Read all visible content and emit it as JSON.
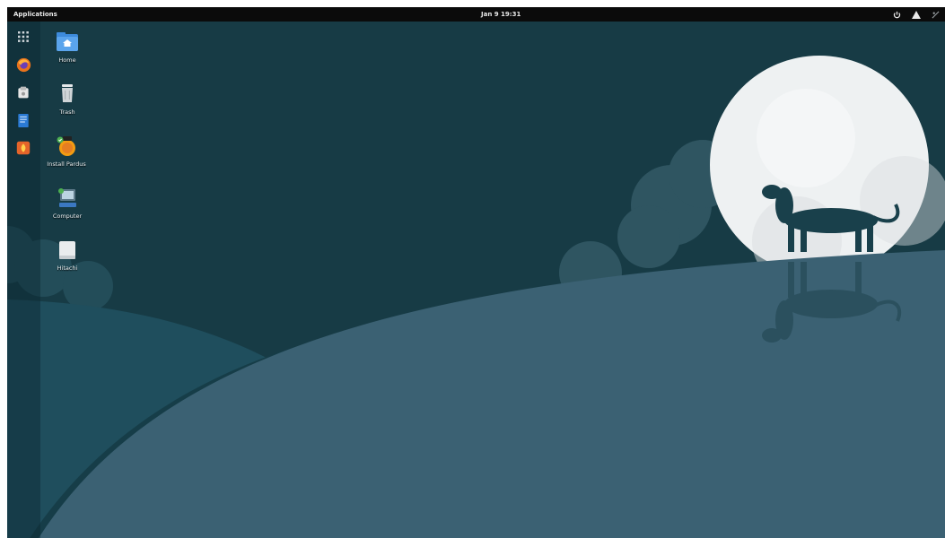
{
  "topbar": {
    "applications_label": "Applications",
    "clock": "Jan 9  19:31",
    "tray_icons": [
      "power-icon",
      "network-icon",
      "volume-icon"
    ]
  },
  "dock": {
    "items": [
      {
        "name": "app-grid-icon",
        "color": "#cfd6da"
      },
      {
        "name": "firefox-icon",
        "color": "#e8731c"
      },
      {
        "name": "software-icon",
        "color": "#e6e6e6"
      },
      {
        "name": "libreoffice-writer-icon",
        "color": "#2a7ad4"
      },
      {
        "name": "installer-icon",
        "color": "#e4642a"
      }
    ]
  },
  "desktop": {
    "icons": [
      {
        "label": "Home",
        "icon": "home-folder-icon"
      },
      {
        "label": "Trash",
        "icon": "trash-icon"
      },
      {
        "label": "Install Pardus",
        "icon": "install-pardus-icon"
      },
      {
        "label": "Computer",
        "icon": "computer-icon"
      },
      {
        "label": "Hitachi",
        "icon": "drive-icon"
      }
    ]
  },
  "wallpaper": {
    "sky_color": "#173b45",
    "hill_color": "#3b6173",
    "moon_color": "#eef1f2"
  }
}
